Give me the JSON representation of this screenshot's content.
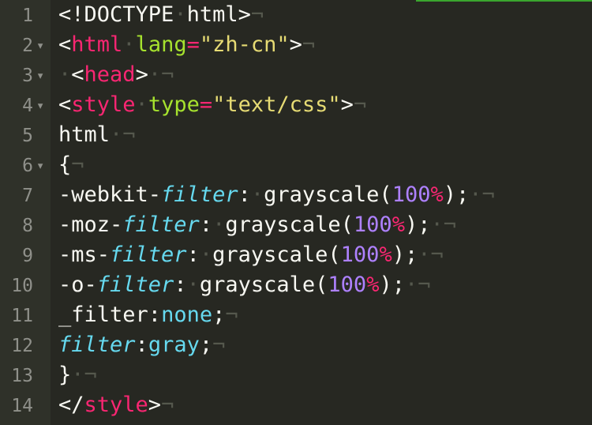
{
  "editor": {
    "accent_color": "#3aa62e",
    "lines": [
      {
        "number": "1",
        "fold": "",
        "tokens": [
          {
            "text": "<!DOCTYPE",
            "type": "plain"
          },
          {
            "text": "·",
            "type": "invisible"
          },
          {
            "text": "html>",
            "type": "plain"
          },
          {
            "text": "¬",
            "type": "invisible"
          }
        ]
      },
      {
        "number": "2",
        "fold": "▾",
        "tokens": [
          {
            "text": "<",
            "type": "plain"
          },
          {
            "text": "html",
            "type": "tag"
          },
          {
            "text": "·",
            "type": "invisible"
          },
          {
            "text": "lang",
            "type": "attr"
          },
          {
            "text": "=",
            "type": "op"
          },
          {
            "text": "\"zh-cn\"",
            "type": "string"
          },
          {
            "text": ">",
            "type": "plain"
          },
          {
            "text": "¬",
            "type": "invisible"
          }
        ]
      },
      {
        "number": "3",
        "fold": "▾",
        "tokens": [
          {
            "text": "·",
            "type": "invisible"
          },
          {
            "text": "<",
            "type": "plain"
          },
          {
            "text": "head",
            "type": "tag"
          },
          {
            "text": ">",
            "type": "plain"
          },
          {
            "text": "·",
            "type": "invisible"
          },
          {
            "text": "¬",
            "type": "invisible"
          }
        ]
      },
      {
        "number": "4",
        "fold": "▾",
        "tokens": [
          {
            "text": "<",
            "type": "plain"
          },
          {
            "text": "style",
            "type": "tag"
          },
          {
            "text": "·",
            "type": "invisible"
          },
          {
            "text": "type",
            "type": "attr"
          },
          {
            "text": "=",
            "type": "op"
          },
          {
            "text": "\"text/css\"",
            "type": "string"
          },
          {
            "text": ">",
            "type": "plain"
          },
          {
            "text": "¬",
            "type": "invisible"
          }
        ]
      },
      {
        "number": "5",
        "fold": "",
        "tokens": [
          {
            "text": "html",
            "type": "plain"
          },
          {
            "text": "·",
            "type": "invisible"
          },
          {
            "text": "¬",
            "type": "invisible"
          }
        ]
      },
      {
        "number": "6",
        "fold": "▾",
        "tokens": [
          {
            "text": "{",
            "type": "plain"
          },
          {
            "text": "¬",
            "type": "invisible"
          }
        ]
      },
      {
        "number": "7",
        "fold": "",
        "tokens": [
          {
            "text": "-webkit-",
            "type": "plain"
          },
          {
            "text": "filter",
            "type": "prop"
          },
          {
            "text": ":",
            "type": "plain"
          },
          {
            "text": "·",
            "type": "invisible"
          },
          {
            "text": "grayscale(",
            "type": "plain"
          },
          {
            "text": "100",
            "type": "number"
          },
          {
            "text": "%",
            "type": "op"
          },
          {
            "text": ");",
            "type": "plain"
          },
          {
            "text": "·",
            "type": "invisible"
          },
          {
            "text": "¬",
            "type": "invisible"
          }
        ]
      },
      {
        "number": "8",
        "fold": "",
        "tokens": [
          {
            "text": "-moz-",
            "type": "plain"
          },
          {
            "text": "filter",
            "type": "prop"
          },
          {
            "text": ":",
            "type": "plain"
          },
          {
            "text": "·",
            "type": "invisible"
          },
          {
            "text": "grayscale(",
            "type": "plain"
          },
          {
            "text": "100",
            "type": "number"
          },
          {
            "text": "%",
            "type": "op"
          },
          {
            "text": ");",
            "type": "plain"
          },
          {
            "text": "·",
            "type": "invisible"
          },
          {
            "text": "¬",
            "type": "invisible"
          }
        ]
      },
      {
        "number": "9",
        "fold": "",
        "tokens": [
          {
            "text": "-ms-",
            "type": "plain"
          },
          {
            "text": "filter",
            "type": "prop"
          },
          {
            "text": ":",
            "type": "plain"
          },
          {
            "text": "·",
            "type": "invisible"
          },
          {
            "text": "grayscale(",
            "type": "plain"
          },
          {
            "text": "100",
            "type": "number"
          },
          {
            "text": "%",
            "type": "op"
          },
          {
            "text": ");",
            "type": "plain"
          },
          {
            "text": "·",
            "type": "invisible"
          },
          {
            "text": "¬",
            "type": "invisible"
          }
        ]
      },
      {
        "number": "10",
        "fold": "",
        "tokens": [
          {
            "text": "-o-",
            "type": "plain"
          },
          {
            "text": "filter",
            "type": "prop"
          },
          {
            "text": ":",
            "type": "plain"
          },
          {
            "text": "·",
            "type": "invisible"
          },
          {
            "text": "grayscale(",
            "type": "plain"
          },
          {
            "text": "100",
            "type": "number"
          },
          {
            "text": "%",
            "type": "op"
          },
          {
            "text": ");",
            "type": "plain"
          },
          {
            "text": "·",
            "type": "invisible"
          },
          {
            "text": "¬",
            "type": "invisible"
          }
        ]
      },
      {
        "number": "11",
        "fold": "",
        "tokens": [
          {
            "text": "_filter",
            "type": "plain"
          },
          {
            "text": ":",
            "type": "plain"
          },
          {
            "text": "none",
            "type": "value"
          },
          {
            "text": ";",
            "type": "plain"
          },
          {
            "text": "¬",
            "type": "invisible"
          }
        ]
      },
      {
        "number": "12",
        "fold": "",
        "tokens": [
          {
            "text": "filter",
            "type": "prop"
          },
          {
            "text": ":",
            "type": "plain"
          },
          {
            "text": "gray",
            "type": "value"
          },
          {
            "text": ";",
            "type": "plain"
          },
          {
            "text": "¬",
            "type": "invisible"
          }
        ]
      },
      {
        "number": "13",
        "fold": "",
        "tokens": [
          {
            "text": "}",
            "type": "plain"
          },
          {
            "text": "·",
            "type": "invisible"
          },
          {
            "text": "¬",
            "type": "invisible"
          }
        ]
      },
      {
        "number": "14",
        "fold": "",
        "tokens": [
          {
            "text": "</",
            "type": "plain"
          },
          {
            "text": "style",
            "type": "tag"
          },
          {
            "text": ">",
            "type": "plain"
          },
          {
            "text": "¬",
            "type": "invisible"
          }
        ]
      }
    ]
  }
}
